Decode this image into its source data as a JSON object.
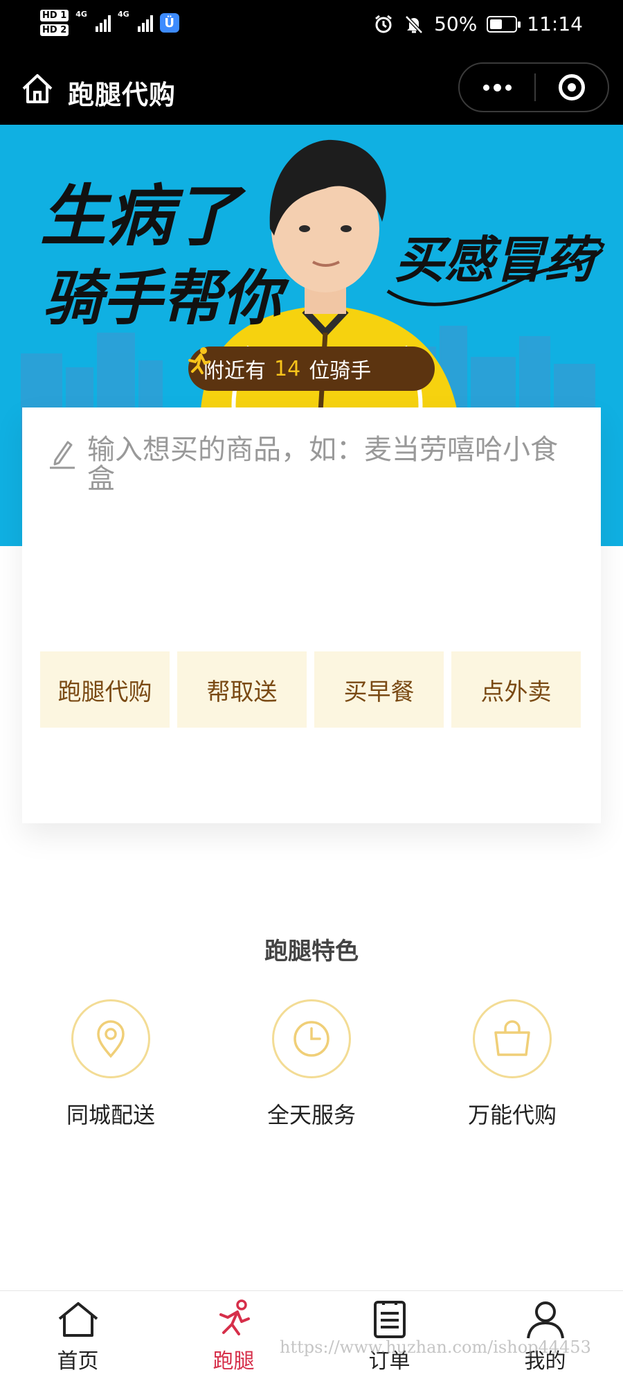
{
  "status_bar": {
    "hd1": "HD 1",
    "hd2": "HD 2",
    "net1": "4G",
    "net2": "4G",
    "battery_percent": "50%",
    "battery_level": 0.5,
    "time": "11:14",
    "icons": [
      "signal-icon",
      "app-badge-icon",
      "alarm-icon",
      "mute-icon",
      "battery-icon"
    ]
  },
  "header": {
    "title": "跑腿代购",
    "home_icon": "home-icon",
    "more_icon": "more-dots-icon",
    "close_icon": "record-ring-icon"
  },
  "banner": {
    "headline_line1": "生病了",
    "headline_line2": "骑手帮你",
    "headline_right": "买感冒药",
    "riders_prefix": "附近有",
    "riders_count": "14",
    "riders_suffix": "位骑手",
    "background_color": "#10b0e2",
    "uniform_color": "#f6d20f"
  },
  "order": {
    "placeholder": "输入想买的商品，如：麦当劳嘻哈小食盒",
    "quick_actions": [
      {
        "label": "跑腿代购"
      },
      {
        "label": "帮取送"
      },
      {
        "label": "买早餐"
      },
      {
        "label": "点外卖"
      }
    ]
  },
  "features": {
    "title": "跑腿特色",
    "items": [
      {
        "label": "同城配送",
        "icon": "location-pin-icon"
      },
      {
        "label": "全天服务",
        "icon": "clock-icon"
      },
      {
        "label": "万能代购",
        "icon": "shopping-bag-icon"
      }
    ],
    "accent_color": "#f3dc95"
  },
  "tab_bar": {
    "active_color": "#d62f4a",
    "tabs": [
      {
        "label": "首页",
        "icon": "home-icon"
      },
      {
        "label": "跑腿",
        "icon": "runner-icon",
        "active": true
      },
      {
        "label": "订单",
        "icon": "order-list-icon"
      },
      {
        "label": "我的",
        "icon": "user-icon"
      }
    ]
  },
  "watermark": "https://www.huzhan.com/ishop44453"
}
